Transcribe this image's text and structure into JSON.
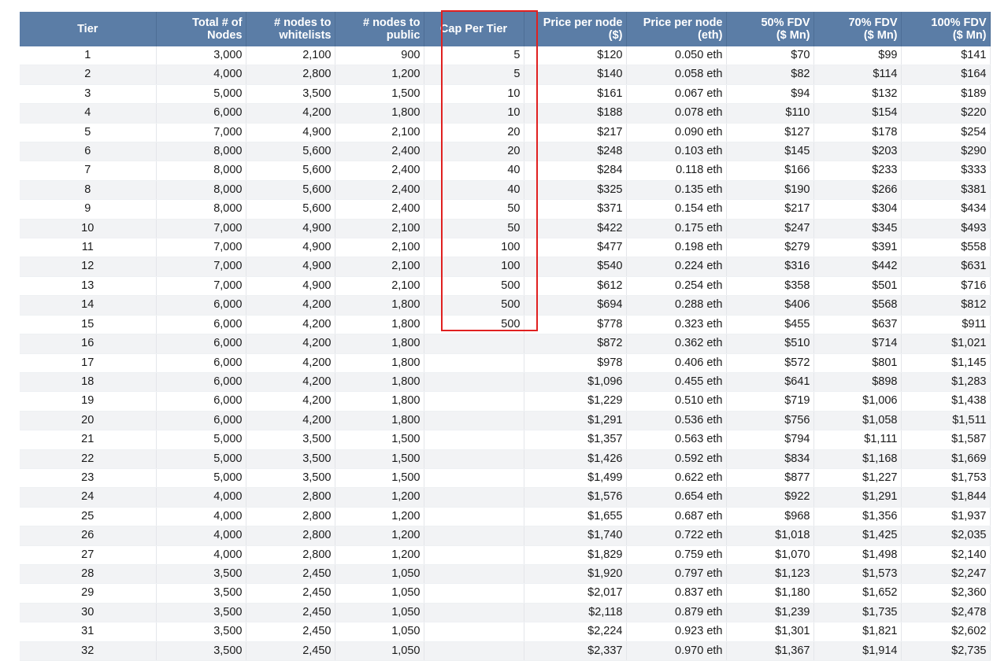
{
  "headers": [
    "Tier",
    "Total # of\nNodes",
    "# nodes to\nwhitelists",
    "# nodes to\npublic",
    "Cap Per Tier",
    "Price per node\n($)",
    "Price per node\n(eth)",
    "50% FDV\n($ Mn)",
    "70% FDV\n($ Mn)",
    "100% FDV\n($ Mn)"
  ],
  "rows": [
    [
      "1",
      "3,000",
      "2,100",
      "900",
      "5",
      "$120",
      "0.050 eth",
      "$70",
      "$99",
      "$141"
    ],
    [
      "2",
      "4,000",
      "2,800",
      "1,200",
      "5",
      "$140",
      "0.058 eth",
      "$82",
      "$114",
      "$164"
    ],
    [
      "3",
      "5,000",
      "3,500",
      "1,500",
      "10",
      "$161",
      "0.067 eth",
      "$94",
      "$132",
      "$189"
    ],
    [
      "4",
      "6,000",
      "4,200",
      "1,800",
      "10",
      "$188",
      "0.078 eth",
      "$110",
      "$154",
      "$220"
    ],
    [
      "5",
      "7,000",
      "4,900",
      "2,100",
      "20",
      "$217",
      "0.090 eth",
      "$127",
      "$178",
      "$254"
    ],
    [
      "6",
      "8,000",
      "5,600",
      "2,400",
      "20",
      "$248",
      "0.103 eth",
      "$145",
      "$203",
      "$290"
    ],
    [
      "7",
      "8,000",
      "5,600",
      "2,400",
      "40",
      "$284",
      "0.118 eth",
      "$166",
      "$233",
      "$333"
    ],
    [
      "8",
      "8,000",
      "5,600",
      "2,400",
      "40",
      "$325",
      "0.135 eth",
      "$190",
      "$266",
      "$381"
    ],
    [
      "9",
      "8,000",
      "5,600",
      "2,400",
      "50",
      "$371",
      "0.154 eth",
      "$217",
      "$304",
      "$434"
    ],
    [
      "10",
      "7,000",
      "4,900",
      "2,100",
      "50",
      "$422",
      "0.175 eth",
      "$247",
      "$345",
      "$493"
    ],
    [
      "11",
      "7,000",
      "4,900",
      "2,100",
      "100",
      "$477",
      "0.198 eth",
      "$279",
      "$391",
      "$558"
    ],
    [
      "12",
      "7,000",
      "4,900",
      "2,100",
      "100",
      "$540",
      "0.224 eth",
      "$316",
      "$442",
      "$631"
    ],
    [
      "13",
      "7,000",
      "4,900",
      "2,100",
      "500",
      "$612",
      "0.254 eth",
      "$358",
      "$501",
      "$716"
    ],
    [
      "14",
      "6,000",
      "4,200",
      "1,800",
      "500",
      "$694",
      "0.288 eth",
      "$406",
      "$568",
      "$812"
    ],
    [
      "15",
      "6,000",
      "4,200",
      "1,800",
      "500",
      "$778",
      "0.323 eth",
      "$455",
      "$637",
      "$911"
    ],
    [
      "16",
      "6,000",
      "4,200",
      "1,800",
      "",
      "$872",
      "0.362 eth",
      "$510",
      "$714",
      "$1,021"
    ],
    [
      "17",
      "6,000",
      "4,200",
      "1,800",
      "",
      "$978",
      "0.406 eth",
      "$572",
      "$801",
      "$1,145"
    ],
    [
      "18",
      "6,000",
      "4,200",
      "1,800",
      "",
      "$1,096",
      "0.455 eth",
      "$641",
      "$898",
      "$1,283"
    ],
    [
      "19",
      "6,000",
      "4,200",
      "1,800",
      "",
      "$1,229",
      "0.510 eth",
      "$719",
      "$1,006",
      "$1,438"
    ],
    [
      "20",
      "6,000",
      "4,200",
      "1,800",
      "",
      "$1,291",
      "0.536 eth",
      "$756",
      "$1,058",
      "$1,511"
    ],
    [
      "21",
      "5,000",
      "3,500",
      "1,500",
      "",
      "$1,357",
      "0.563 eth",
      "$794",
      "$1,111",
      "$1,587"
    ],
    [
      "22",
      "5,000",
      "3,500",
      "1,500",
      "",
      "$1,426",
      "0.592 eth",
      "$834",
      "$1,168",
      "$1,669"
    ],
    [
      "23",
      "5,000",
      "3,500",
      "1,500",
      "",
      "$1,499",
      "0.622 eth",
      "$877",
      "$1,227",
      "$1,753"
    ],
    [
      "24",
      "4,000",
      "2,800",
      "1,200",
      "",
      "$1,576",
      "0.654 eth",
      "$922",
      "$1,291",
      "$1,844"
    ],
    [
      "25",
      "4,000",
      "2,800",
      "1,200",
      "",
      "$1,655",
      "0.687 eth",
      "$968",
      "$1,356",
      "$1,937"
    ],
    [
      "26",
      "4,000",
      "2,800",
      "1,200",
      "",
      "$1,740",
      "0.722 eth",
      "$1,018",
      "$1,425",
      "$2,035"
    ],
    [
      "27",
      "4,000",
      "2,800",
      "1,200",
      "",
      "$1,829",
      "0.759 eth",
      "$1,070",
      "$1,498",
      "$2,140"
    ],
    [
      "28",
      "3,500",
      "2,450",
      "1,050",
      "",
      "$1,920",
      "0.797 eth",
      "$1,123",
      "$1,573",
      "$2,247"
    ],
    [
      "29",
      "3,500",
      "2,450",
      "1,050",
      "",
      "$2,017",
      "0.837 eth",
      "$1,180",
      "$1,652",
      "$2,360"
    ],
    [
      "30",
      "3,500",
      "2,450",
      "1,050",
      "",
      "$2,118",
      "0.879 eth",
      "$1,239",
      "$1,735",
      "$2,478"
    ],
    [
      "31",
      "3,500",
      "2,450",
      "1,050",
      "",
      "$2,224",
      "0.923 eth",
      "$1,301",
      "$1,821",
      "$2,602"
    ],
    [
      "32",
      "3,500",
      "2,450",
      "1,050",
      "",
      "$2,337",
      "0.970 eth",
      "$1,367",
      "$1,914",
      "$2,735"
    ]
  ],
  "colors": {
    "header_bg": "#5b7da6",
    "header_text": "#ffffff",
    "stripe": "#f2f3f5",
    "highlight": "#e02020"
  }
}
